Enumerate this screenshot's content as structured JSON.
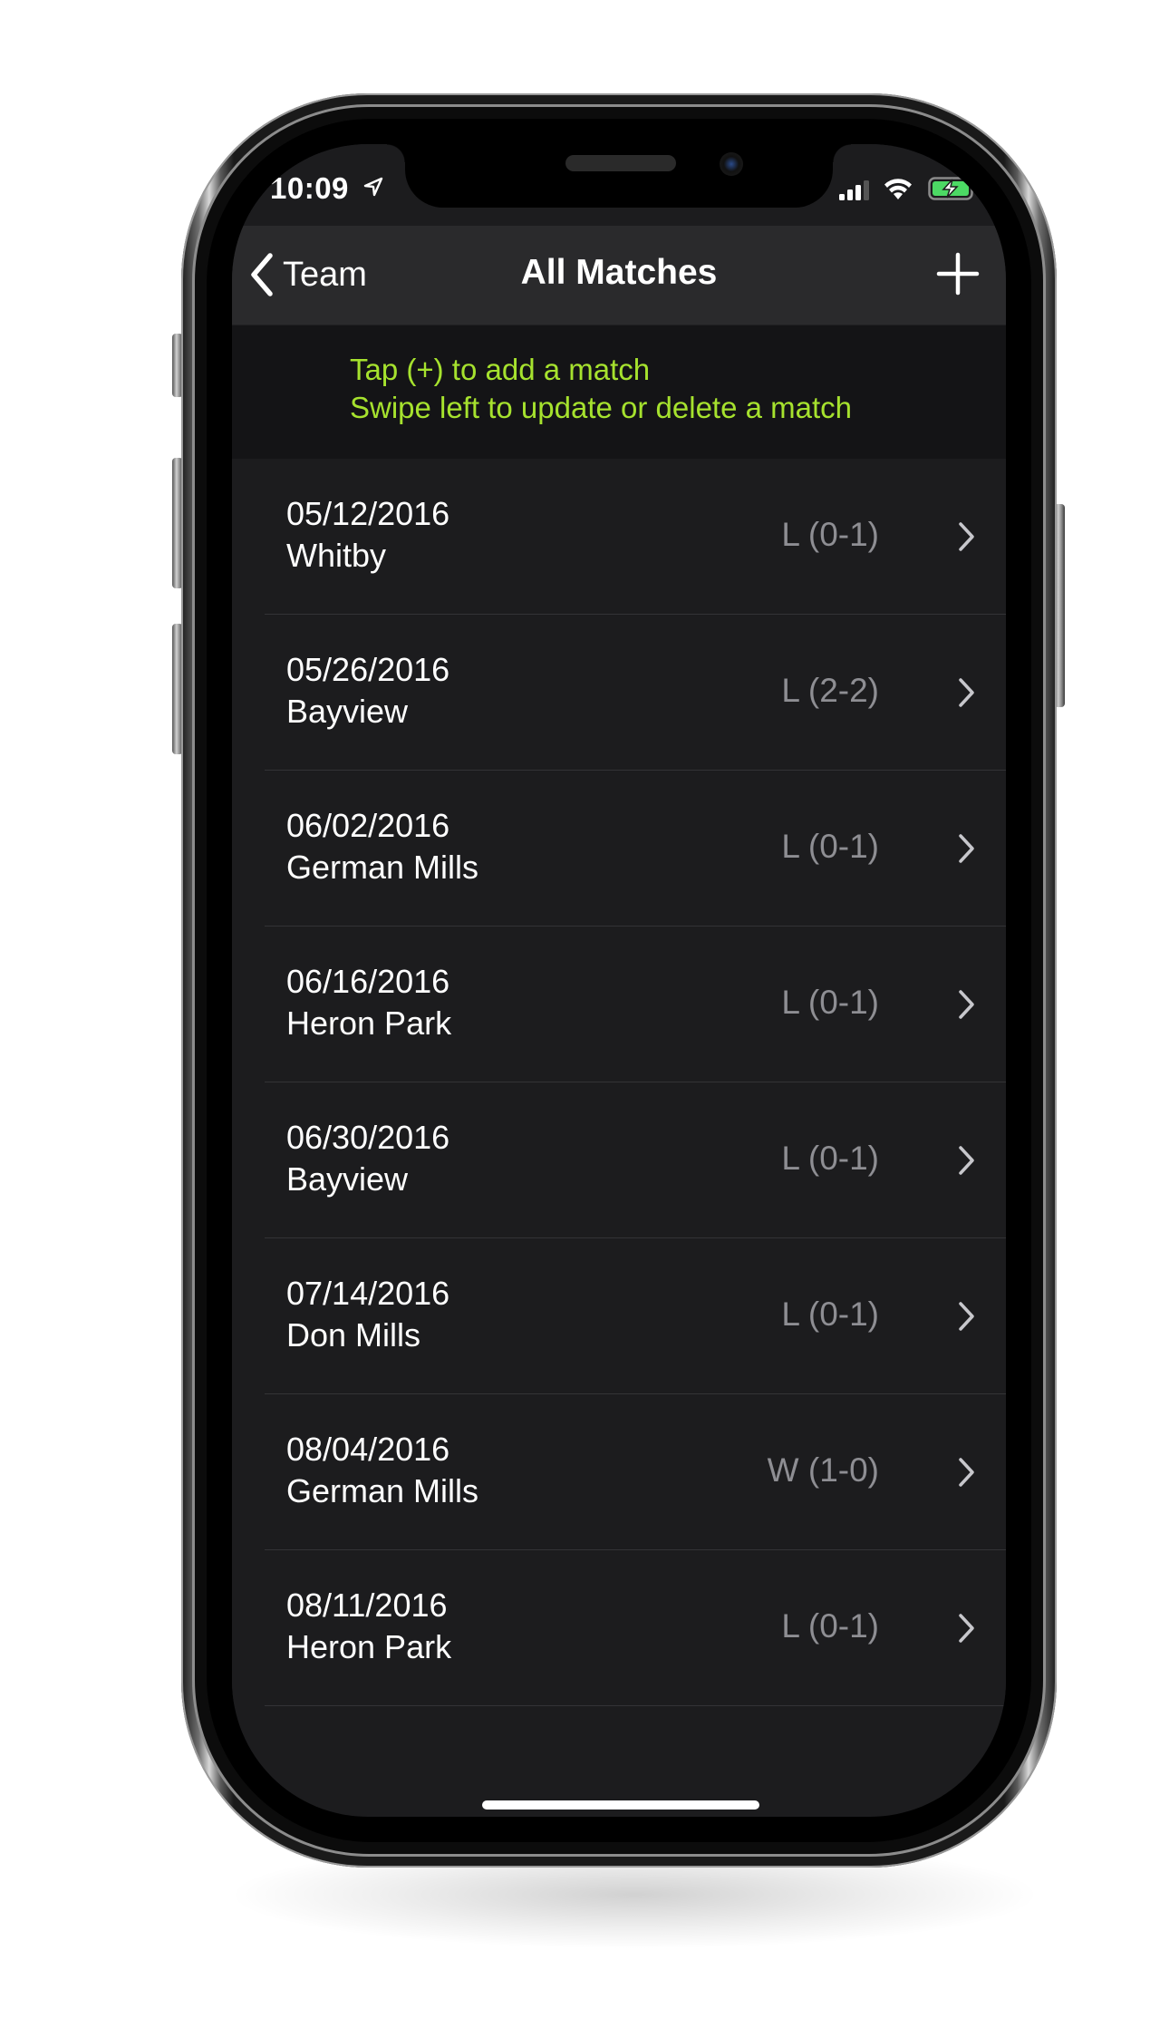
{
  "status_bar": {
    "time": "10:09",
    "icons": [
      "location-arrow-icon",
      "cellular-signal-icon",
      "wifi-icon",
      "battery-charging-icon"
    ],
    "battery_color": "#4cd964"
  },
  "nav": {
    "back_label": "Team",
    "title": "All Matches",
    "add_icon": "plus-icon"
  },
  "hint": {
    "line1": "Tap (+) to add a match",
    "line2": "Swipe left to update or delete a match",
    "color": "#a6e22e"
  },
  "matches": [
    {
      "date": "05/12/2016",
      "opponent": "Whitby",
      "result": "L (0-1)"
    },
    {
      "date": "05/26/2016",
      "opponent": "Bayview",
      "result": "L (2-2)"
    },
    {
      "date": "06/02/2016",
      "opponent": "German Mills",
      "result": "L (0-1)"
    },
    {
      "date": "06/16/2016",
      "opponent": "Heron Park",
      "result": "L (0-1)"
    },
    {
      "date": "06/30/2016",
      "opponent": "Bayview",
      "result": "L (0-1)"
    },
    {
      "date": "07/14/2016",
      "opponent": "Don Mills",
      "result": "L (0-1)"
    },
    {
      "date": "08/04/2016",
      "opponent": "German Mills",
      "result": "W (1-0)"
    },
    {
      "date": "08/11/2016",
      "opponent": "Heron Park",
      "result": "L (0-1)"
    }
  ],
  "theme": {
    "background": "#1c1c1e",
    "navbar": "#2a2a2c",
    "result_color": "#8e8e93"
  }
}
